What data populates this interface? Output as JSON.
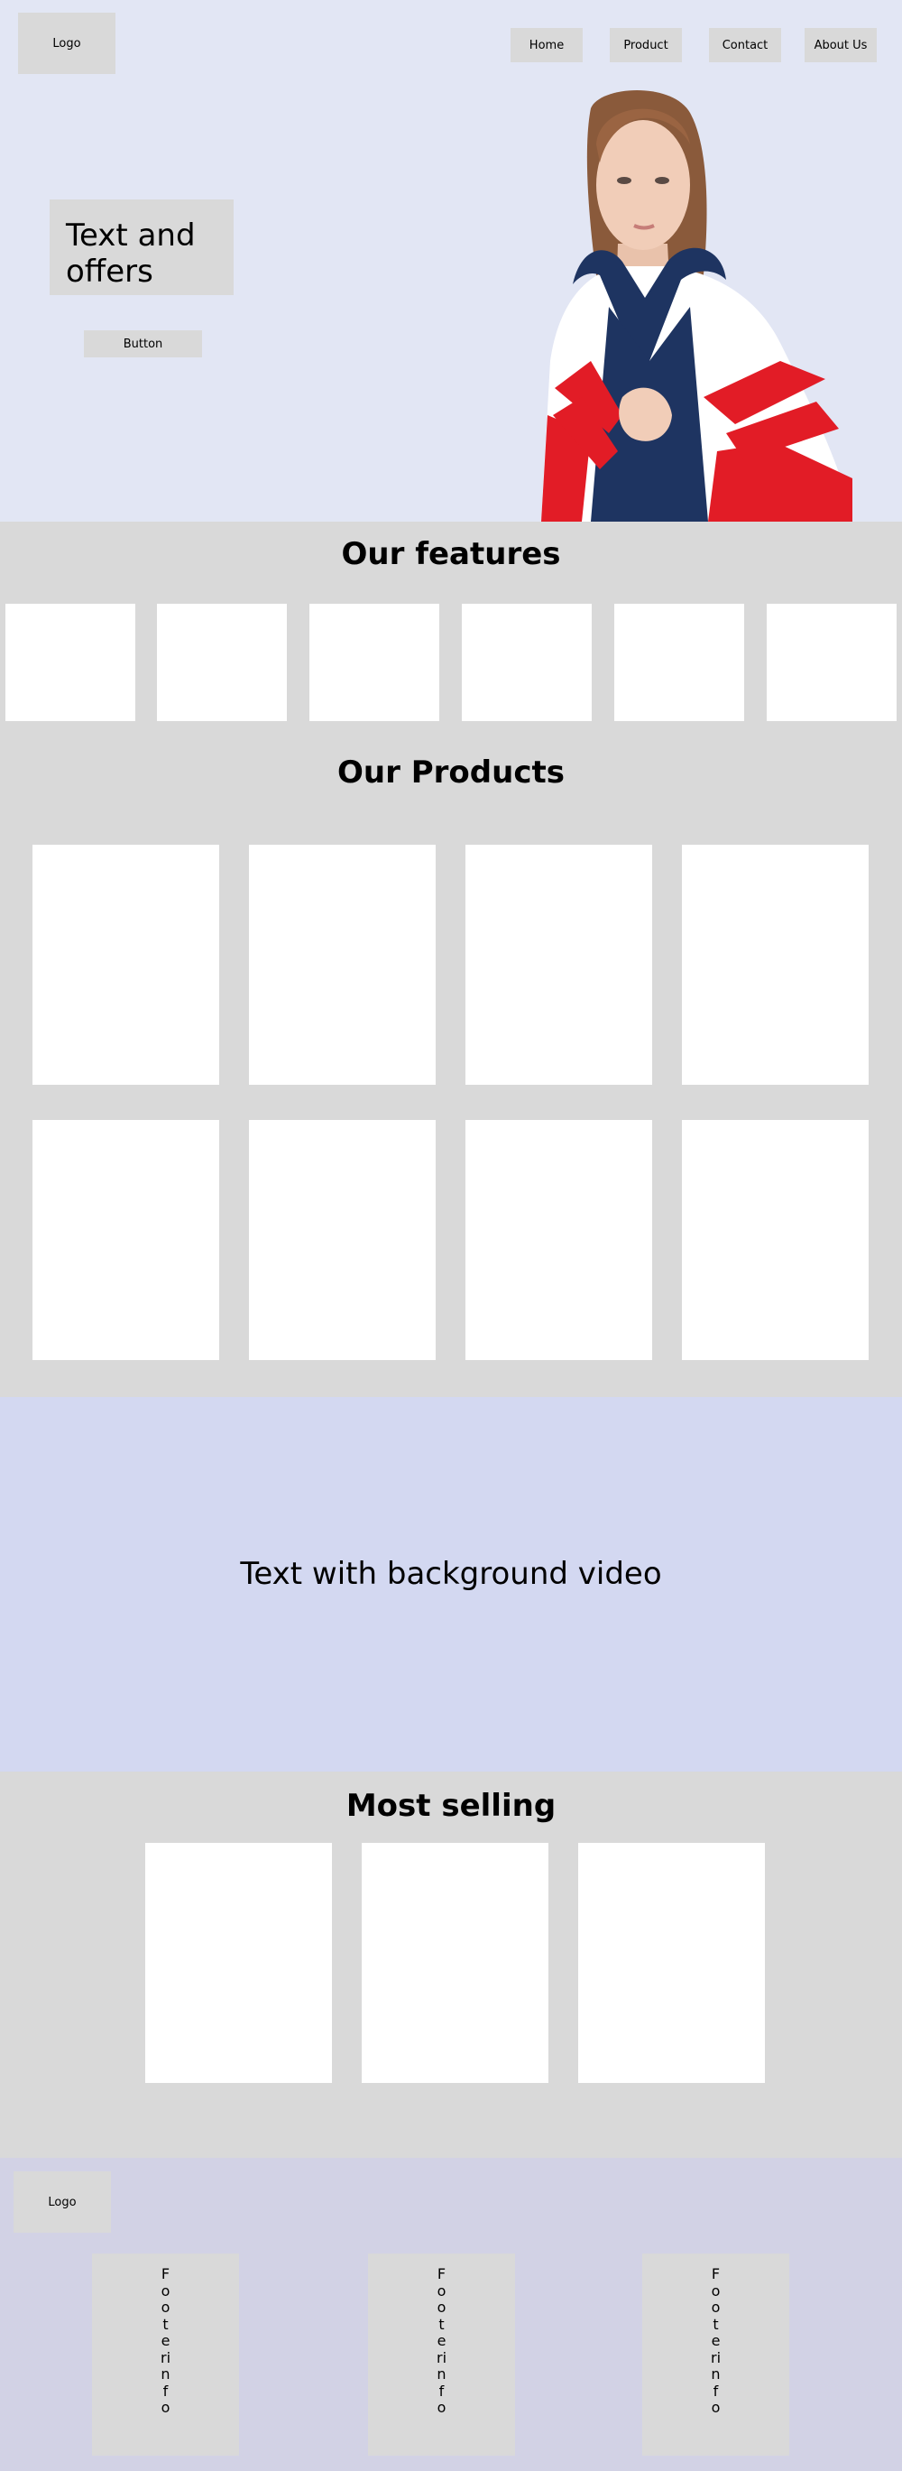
{
  "header": {
    "logo": "Logo",
    "nav": [
      "Home",
      "Product",
      "Contact",
      "About Us"
    ]
  },
  "hero": {
    "offer_text": "Text and offers",
    "button_label": "Button"
  },
  "features": {
    "title": "Our features",
    "count": 6
  },
  "products": {
    "title": "Our Products"
  },
  "video": {
    "text": "Text with background video"
  },
  "most_selling": {
    "title": "Most selling"
  },
  "footer": {
    "logo": "Logo",
    "columns": [
      "Footerinfo",
      "Footerinfo",
      "Footerinfo"
    ]
  },
  "colors": {
    "hero_bg": "#e2e6f4",
    "section_bg": "#d9d9d9",
    "video_bg": "#d3d8f1",
    "footer_bg": "#d2d2e5",
    "jacket_navy": "#1e3461",
    "jacket_red": "#e21c26"
  }
}
